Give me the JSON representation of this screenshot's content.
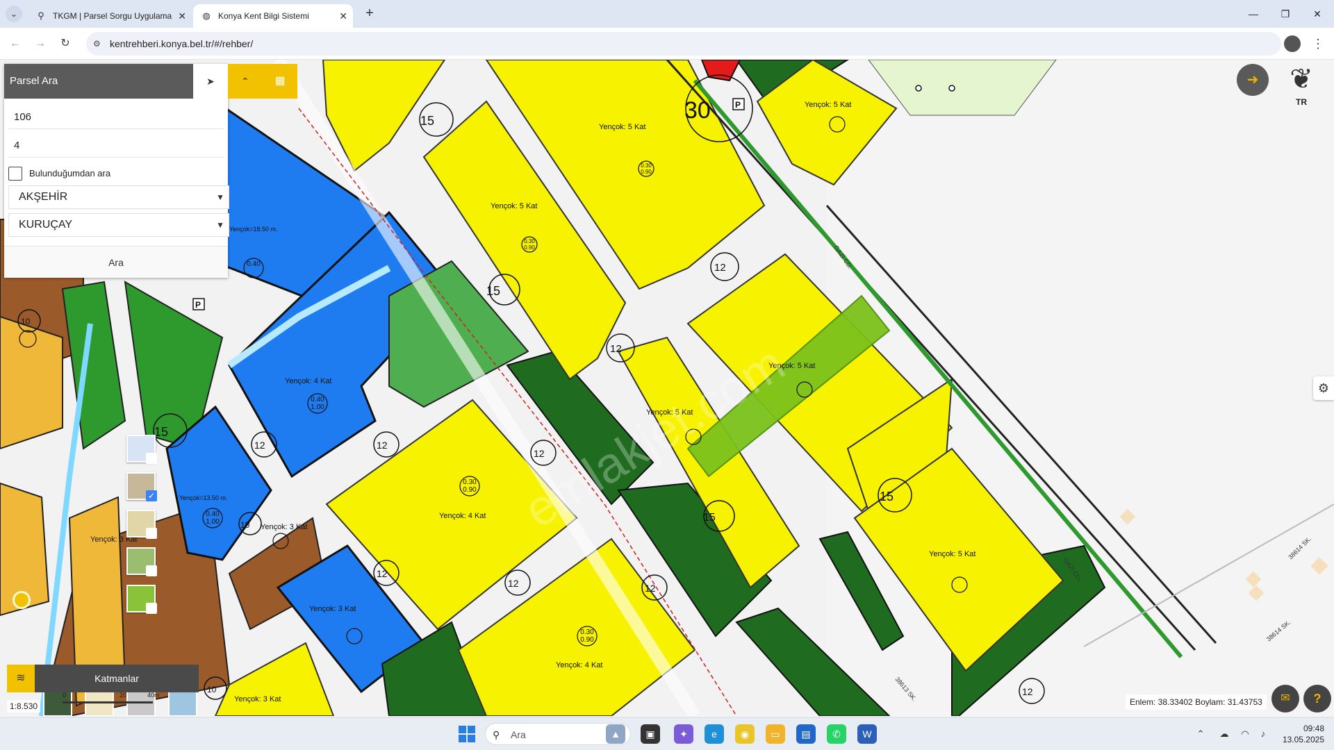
{
  "browser": {
    "tabs": [
      {
        "title": "TKGM | Parsel Sorgu Uygulama",
        "favicon": "location-pin-icon",
        "active": false
      },
      {
        "title": "Konya Kent Bilgi Sistemi",
        "favicon": "globe-icon",
        "active": true
      }
    ],
    "url": "kentrehberi.konya.bel.tr/#/rehber/"
  },
  "parsel_panel": {
    "title": "Parsel Ara",
    "ada_value": "106",
    "parsel_value": "4",
    "location_checkbox_label": "Bulunduğumdan ara",
    "location_checked": false,
    "district": "AKŞEHİR",
    "neighborhood": "KURUÇAY",
    "search_button": "Ara"
  },
  "map": {
    "logo_text": "TR",
    "layers_label": "Katmanlar",
    "scale_text": "1:8.530",
    "scale_ticks": [
      "0",
      "20",
      "40m"
    ],
    "coordinates": "Enlem: 38.33402 Boylam: 31.43753",
    "watermark": "emlakjet.com",
    "zone_labels": {
      "y5": "Yençok: 5 Kat",
      "y4": "Yençok: 4 Kat",
      "y3": "Yençok: 3 Kat",
      "h1850": "Yençok=18.50 m.",
      "h1350": "Yençok=13.50 m."
    },
    "road_widths": {
      "w30": "30",
      "w15": "15",
      "w12": "12",
      "w10": "10"
    },
    "ratios": {
      "r1": "0.30",
      "r2": "0.90",
      "r3": "0.40",
      "r4": "1.00"
    },
    "street_labels": {
      "gazi": "GAZİ CD.",
      "s38614": "38614 SK.",
      "s38613": "38613 SK."
    },
    "colors": {
      "residential": "#f7f200",
      "public": "#1e7cf0",
      "park": "#2e9a2e",
      "dark_green": "#1f6b1f",
      "commercial": "#9b5a2a",
      "selected": "#7cc21c",
      "accent": "#f2c200"
    }
  },
  "taskbar": {
    "search_placeholder": "Ara",
    "time": "09:48",
    "date": "13.05.2025"
  }
}
